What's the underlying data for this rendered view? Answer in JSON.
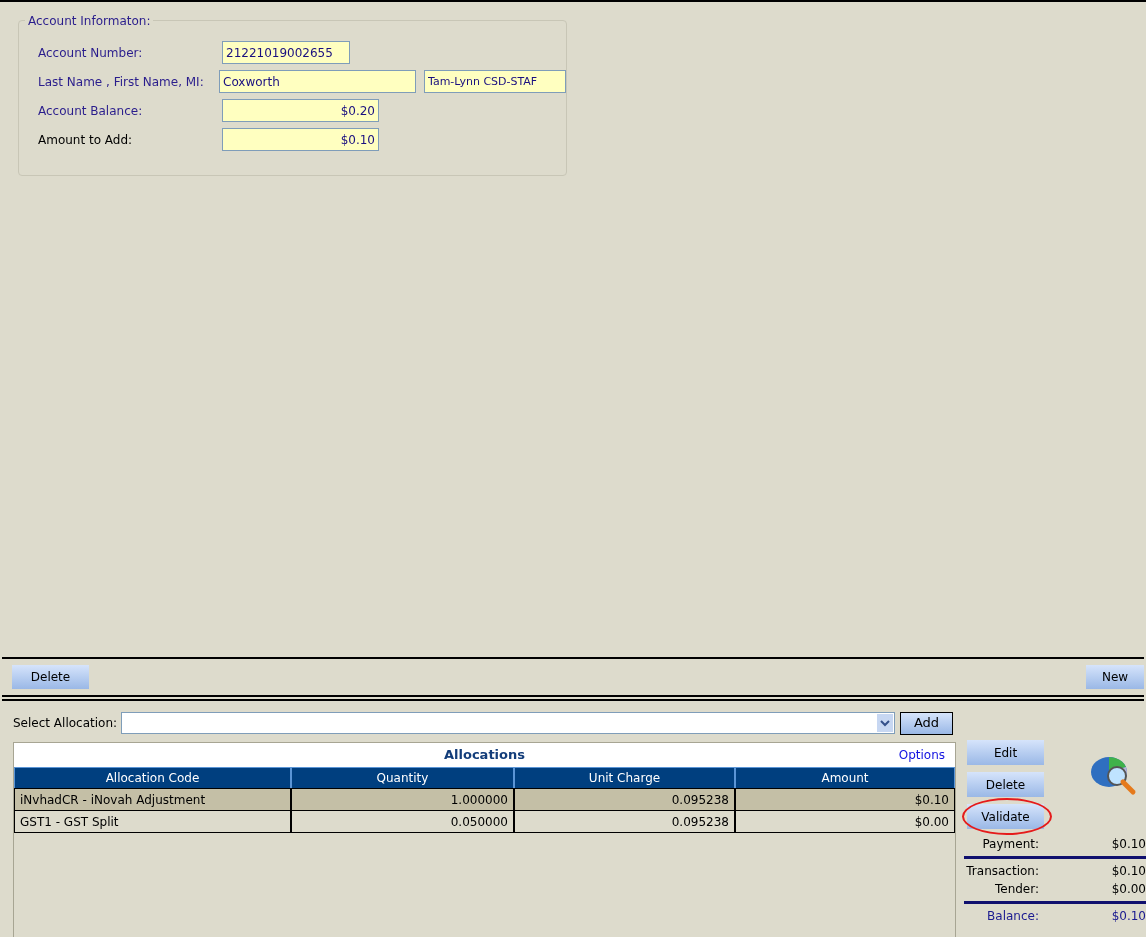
{
  "account_info": {
    "legend": "Account Informaton:",
    "fields": [
      {
        "label": "Account Number:",
        "values": [
          "21221019002655"
        ],
        "numeric": false
      },
      {
        "label": "Last Name , First Name, MI:",
        "values": [
          "Coxworth",
          "Tam-Lynn CSD-STAF"
        ],
        "numeric": false
      },
      {
        "label": "Account Balance:",
        "values": [
          "$0.20"
        ],
        "numeric": true
      },
      {
        "label": "Amount to Add:",
        "values": [
          "$0.10"
        ],
        "numeric": true
      }
    ]
  },
  "toolbar": {
    "left_button": "Delete",
    "right_button": "New"
  },
  "select_allocation": {
    "label": "Select Allocation:",
    "add_button": "Add"
  },
  "allocations": {
    "title": "Allocations",
    "options_link": "Options",
    "columns": [
      "Allocation Code",
      "Quantity",
      "Unit Charge",
      "Amount"
    ],
    "rows": [
      {
        "cells": [
          "iNvhadCR - iNovah Adjustment",
          "1.000000",
          "0.095238",
          "$0.10"
        ],
        "selected": true
      },
      {
        "cells": [
          "GST1 - GST Split",
          "0.050000",
          "0.095238",
          "$0.00"
        ],
        "selected": false
      }
    ]
  },
  "side_buttons": [
    {
      "label": "Edit",
      "circled": false
    },
    {
      "label": "Delete",
      "circled": false
    },
    {
      "label": "Validate",
      "circled": true
    }
  ],
  "summary": [
    [
      {
        "label": "Payment:",
        "value": "$0.10"
      }
    ],
    [
      {
        "label": "Transaction:",
        "value": "$0.10"
      },
      {
        "label": "Tender:",
        "value": "$0.00"
      }
    ],
    [
      {
        "label": "Balance:",
        "value": "$0.10",
        "emphasis": true
      }
    ]
  ]
}
